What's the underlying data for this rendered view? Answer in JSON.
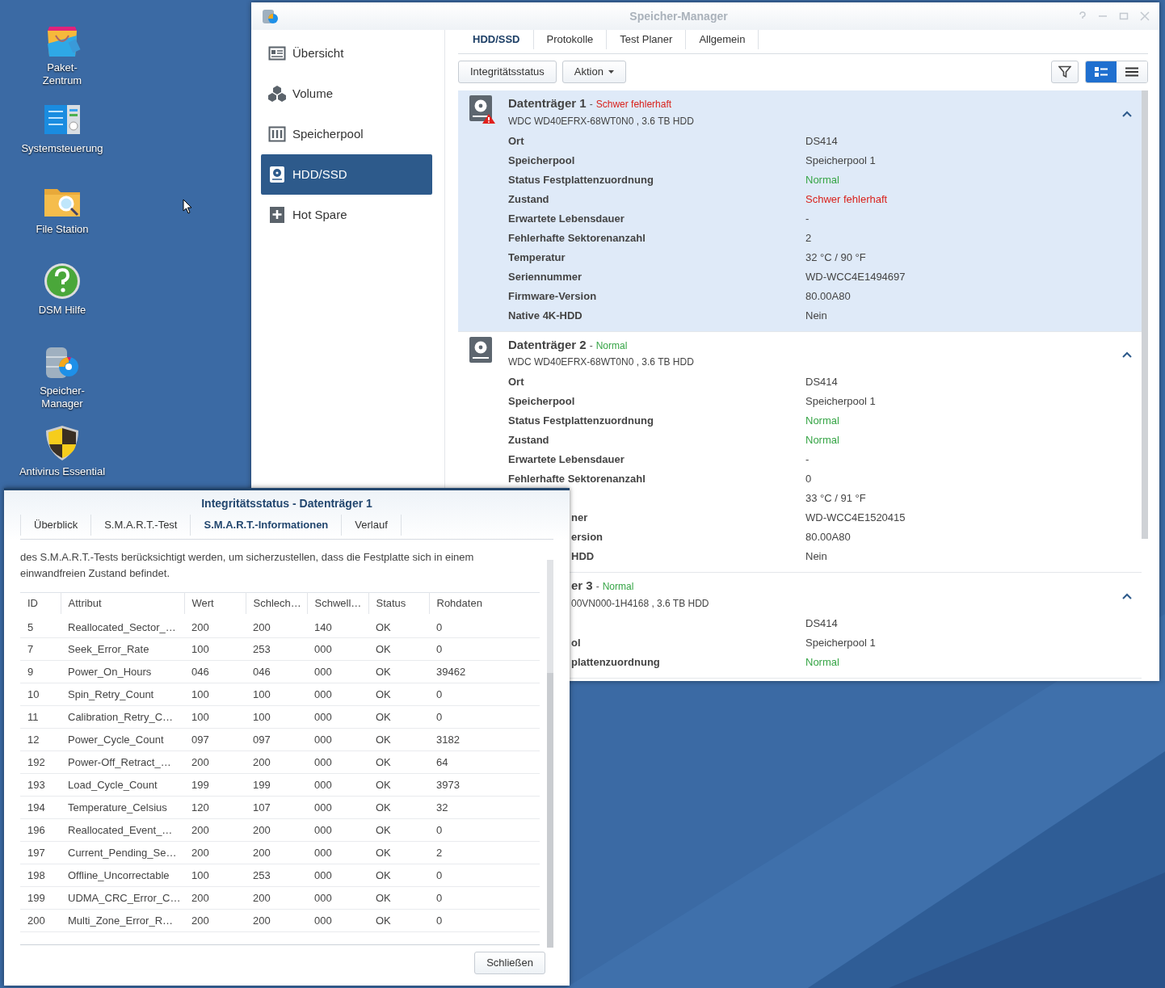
{
  "desktop": {
    "icons": [
      {
        "label": "Paket-\nZentrum",
        "kind": "package"
      },
      {
        "label": "Systemsteuerung",
        "kind": "control"
      },
      {
        "label": "File Station",
        "kind": "folder"
      },
      {
        "label": "DSM Hilfe",
        "kind": "help"
      },
      {
        "label": "Speicher-\nManager",
        "kind": "storage"
      },
      {
        "label": "Antivirus Essential",
        "kind": "shield"
      }
    ]
  },
  "app_window": {
    "title": "Speicher-Manager",
    "sidebar": [
      {
        "label": "Übersicht",
        "kind": "overview",
        "selected": false
      },
      {
        "label": "Volume",
        "kind": "volume",
        "selected": false
      },
      {
        "label": "Speicherpool",
        "kind": "pool",
        "selected": false
      },
      {
        "label": "HDD/SSD",
        "kind": "disk",
        "selected": true
      },
      {
        "label": "Hot Spare",
        "kind": "spare",
        "selected": false
      }
    ],
    "tabs": [
      {
        "label": "HDD/SSD",
        "selected": true
      },
      {
        "label": "Protokolle",
        "selected": false
      },
      {
        "label": "Test Planer",
        "selected": false
      },
      {
        "label": "Allgemein",
        "selected": false
      }
    ],
    "toolbar": {
      "buttons": [
        {
          "label": "Integritätsstatus",
          "dropdown": false
        },
        {
          "label": "Aktion",
          "dropdown": true
        }
      ],
      "view_modes": [
        {
          "kind": "detail",
          "selected": true
        },
        {
          "kind": "list",
          "selected": false
        }
      ]
    },
    "disks": [
      {
        "title": "Datenträger 1",
        "separator": "-",
        "status": "Schwer fehlerhaft",
        "color": "#d9221c",
        "warning": true,
        "selected": true,
        "expanded": true,
        "cut_off": false,
        "model": "WDC WD40EFRX-68WT0N0 , 3.6 TB HDD",
        "details": [
          {
            "label": "Ort",
            "value": "DS414",
            "color": "#444444"
          },
          {
            "label": "Speicherpool",
            "value": "Speicherpool 1",
            "color": "#444444"
          },
          {
            "label": "Status Festplattenzuordnung",
            "value": "Normal",
            "color": "#36a546"
          },
          {
            "label": "Zustand",
            "value": "Schwer fehlerhaft",
            "color": "#d9221c"
          },
          {
            "label": "Erwartete Lebensdauer",
            "value": "-"
          },
          {
            "label": "Fehlerhafte Sektorenanzahl",
            "value": "2",
            "color": "#444444"
          },
          {
            "label": "Temperatur",
            "value": "32 °C / 90 °F",
            "color": "#444444"
          },
          {
            "label": "Seriennummer",
            "value": "WD-WCC4E1494697",
            "color": "#444444"
          },
          {
            "label": "Firmware-Version",
            "value": "80.00A80",
            "color": "#444444"
          },
          {
            "label": "Native 4K-HDD",
            "value": "Nein",
            "color": "#444444"
          }
        ]
      },
      {
        "title": "Datenträger 2",
        "separator": "-",
        "status": "Normal",
        "color": "#36a546",
        "warning": false,
        "selected": false,
        "expanded": true,
        "cut_off": false,
        "model": "WDC WD40EFRX-68WT0N0 , 3.6 TB HDD",
        "details": [
          {
            "label": "Ort",
            "value": "DS414",
            "color": "#444444"
          },
          {
            "label": "Speicherpool",
            "value": "Speicherpool 1",
            "color": "#444444"
          },
          {
            "label": "Status Festplattenzuordnung",
            "value": "Normal",
            "color": "#36a546"
          },
          {
            "label": "Zustand",
            "value": "Normal",
            "color": "#36a546"
          },
          {
            "label": "Erwartete Lebensdauer",
            "value": "-"
          },
          {
            "label": "Fehlerhafte Sektorenanzahl",
            "value": "0",
            "color": "#444444"
          },
          {
            "value": "33 °C / 91 °F",
            "color": "#444444"
          },
          {
            "label": "ner",
            "cut_off": true,
            "value": "WD-WCC4E1520415",
            "color": "#444444"
          },
          {
            "label": "ersion",
            "cut_off": true,
            "value": "80.00A80",
            "color": "#444444"
          },
          {
            "label": "HDD",
            "cut_off": true,
            "value": "Nein",
            "color": "#444444"
          }
        ]
      },
      {
        "title": "er 3",
        "separator": "-",
        "status": "Normal",
        "color": "#36a546",
        "warning": false,
        "selected": false,
        "expanded": true,
        "cut_off": true,
        "model": "00VN000-1H4168 , 3.6 TB HDD",
        "details": [
          {
            "value": "DS414",
            "color": "#444444"
          },
          {
            "label": "ol",
            "cut_off": true,
            "value": "Speicherpool 1",
            "color": "#444444"
          },
          {
            "label": "plattenzuordnung",
            "cut_off": true,
            "value": "Normal",
            "color": "#36a546"
          }
        ]
      }
    ]
  },
  "dialog": {
    "title": "Integritätsstatus - Datenträger 1",
    "tabs": [
      {
        "label": "Überblick",
        "selected": false
      },
      {
        "label": "S.M.A.R.T.-Test",
        "selected": false
      },
      {
        "label": "S.M.A.R.T.-Informationen",
        "selected": true
      },
      {
        "label": "Verlauf",
        "selected": false
      }
    ],
    "description": "des S.M.A.R.T.-Tests berücksichtigt werden, um sicherzustellen, dass die Festplatte sich in einem einwandfreien Zustand befindet.",
    "table": {
      "columns": [
        "ID",
        "Attribut",
        "Wert",
        "Schlech…",
        "Schwell…",
        "Status",
        "Rohdaten"
      ],
      "rows": [
        [
          "5",
          "Reallocated_Sector_…",
          "200",
          "200",
          "140",
          "OK",
          "0"
        ],
        [
          "7",
          "Seek_Error_Rate",
          "100",
          "253",
          "000",
          "OK",
          "0"
        ],
        [
          "9",
          "Power_On_Hours",
          "046",
          "046",
          "000",
          "OK",
          "39462"
        ],
        [
          "10",
          "Spin_Retry_Count",
          "100",
          "100",
          "000",
          "OK",
          "0"
        ],
        [
          "11",
          "Calibration_Retry_C…",
          "100",
          "100",
          "000",
          "OK",
          "0"
        ],
        [
          "12",
          "Power_Cycle_Count",
          "097",
          "097",
          "000",
          "OK",
          "3182"
        ],
        [
          "192",
          "Power-Off_Retract_…",
          "200",
          "200",
          "000",
          "OK",
          "64"
        ],
        [
          "193",
          "Load_Cycle_Count",
          "199",
          "199",
          "000",
          "OK",
          "3973"
        ],
        [
          "194",
          "Temperature_Celsius",
          "120",
          "107",
          "000",
          "OK",
          "32"
        ],
        [
          "196",
          "Reallocated_Event_…",
          "200",
          "200",
          "000",
          "OK",
          "0"
        ],
        [
          "197",
          "Current_Pending_Se…",
          "200",
          "200",
          "000",
          "OK",
          "2"
        ],
        [
          "198",
          "Offline_Uncorrectable",
          "100",
          "253",
          "000",
          "OK",
          "0"
        ],
        [
          "199",
          "UDMA_CRC_Error_C…",
          "200",
          "200",
          "000",
          "OK",
          "0"
        ],
        [
          "200",
          "Multi_Zone_Error_R…",
          "200",
          "200",
          "000",
          "OK",
          "0"
        ]
      ]
    },
    "buttons": [
      {
        "label": "Schließen"
      }
    ]
  }
}
